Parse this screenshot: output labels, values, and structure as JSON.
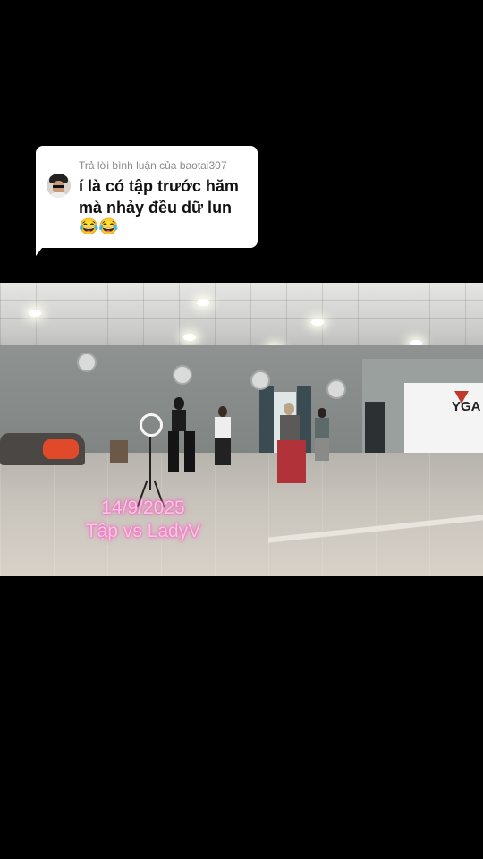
{
  "reply": {
    "header": "Trả lời bình luận của baotai307",
    "comment": "í là có tập trước hăm mà nhảy đều dữ lun",
    "emojis": "😂😂"
  },
  "video": {
    "overlay_line1": "14/9/2025",
    "overlay_line2": "Tập vs LadyV",
    "banner_logo": "YGA"
  }
}
